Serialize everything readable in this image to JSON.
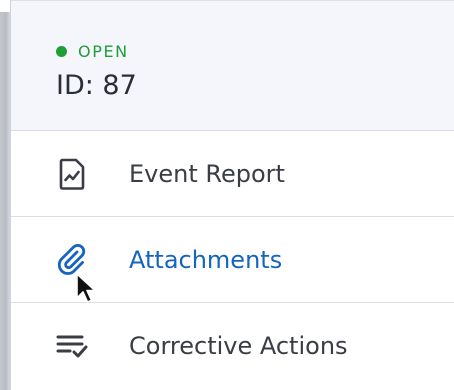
{
  "record": {
    "status": "OPEN",
    "id_label": "ID: 87"
  },
  "menu": {
    "items": [
      {
        "label": "Event Report",
        "icon": "document-chart-icon",
        "active": false
      },
      {
        "label": "Attachments",
        "icon": "paperclip-icon",
        "active": true
      },
      {
        "label": "Corrective Actions",
        "icon": "checklist-icon",
        "active": false
      }
    ]
  },
  "colors": {
    "status_open": "#1f9e3a",
    "active_link": "#1565c0",
    "header_bg": "#f4f6fb",
    "text": "#3a3d45"
  }
}
